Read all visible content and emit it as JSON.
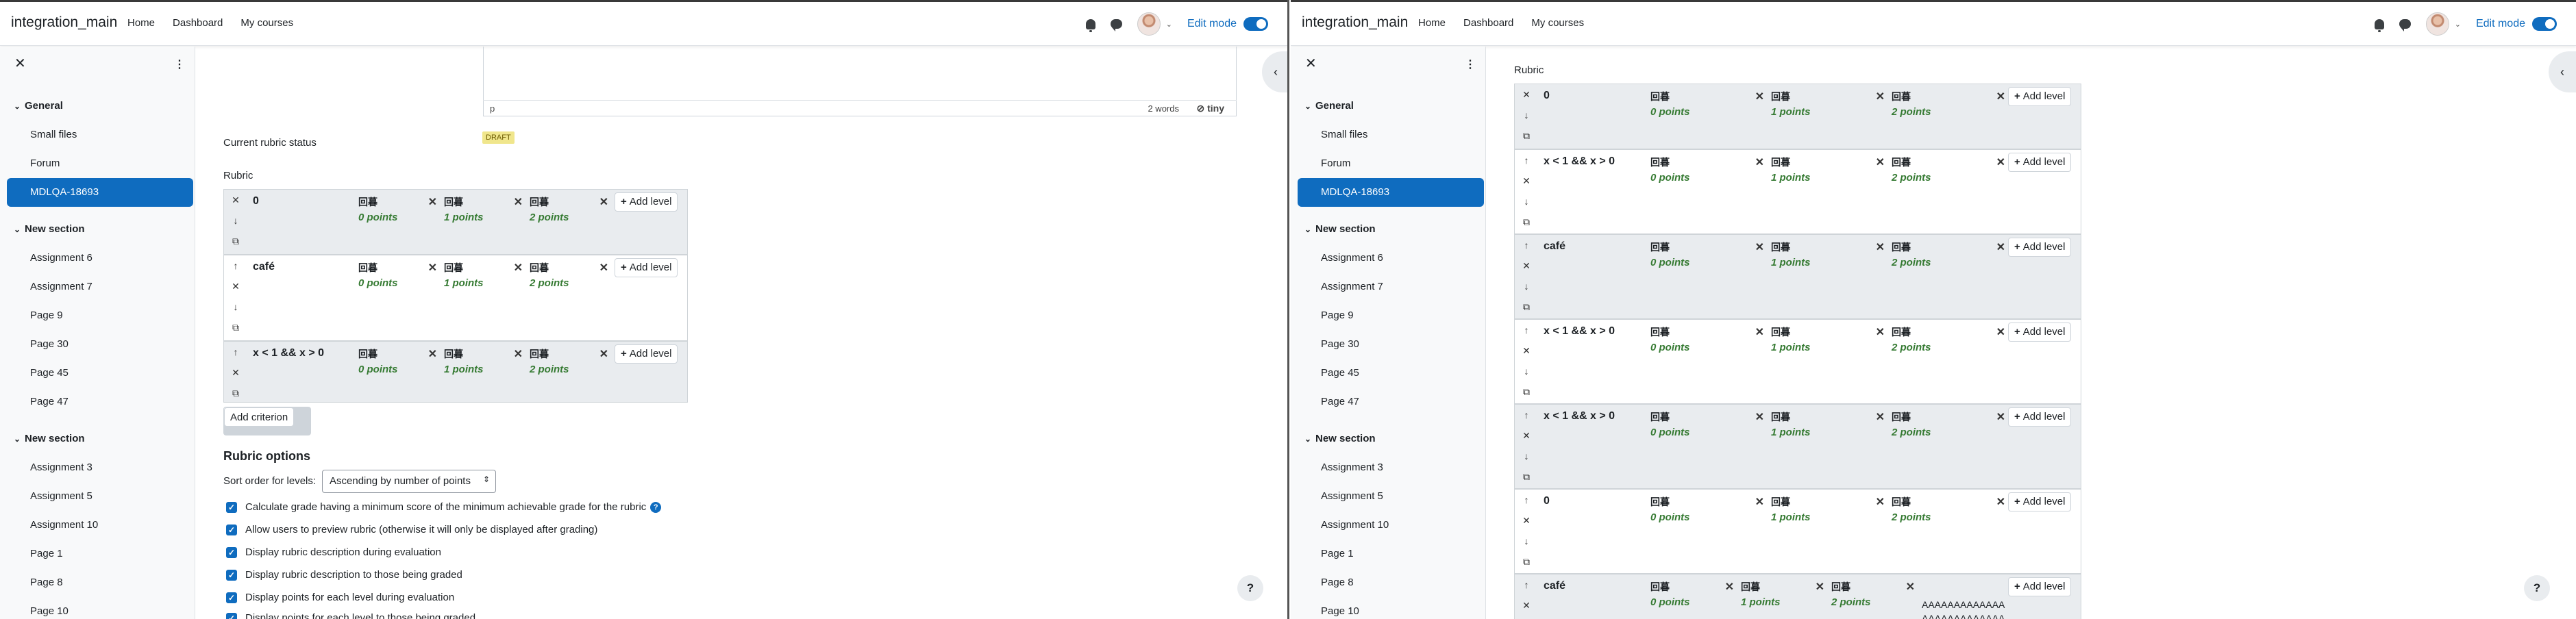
{
  "navbar": {
    "brand": "integration_main",
    "links": [
      "Home",
      "Dashboard",
      "My courses"
    ],
    "edit_mode_label": "Edit mode"
  },
  "drawer": {
    "close_glyph": "✕",
    "menu_glyph": "⋮",
    "sections": [
      {
        "title": "General",
        "items": [
          "Small files",
          "Forum",
          "MDLQA-18693"
        ]
      },
      {
        "title": "New section",
        "items": [
          "Assignment 6",
          "Assignment 7",
          "Page 9",
          "Page 30",
          "Page 45",
          "Page 47"
        ]
      },
      {
        "title": "New section",
        "items": [
          "Assignment 3",
          "Assignment 5",
          "Assignment 10",
          "Page 1",
          "Page 8",
          "Page 10"
        ]
      }
    ],
    "active_item": "MDLQA-18693"
  },
  "editor": {
    "status_path": "p",
    "word_count": "2 words",
    "brand": "tiny"
  },
  "current_status_label": "Current rubric status",
  "draft_badge": "DRAFT",
  "rubric_label": "Rubric",
  "add_level_label": "Add level",
  "add_criterion_label": "Add criterion",
  "level_defs": [
    "回暮",
    "回暮",
    "回暮"
  ],
  "level_points": [
    "0 points",
    "1 points",
    "2 points"
  ],
  "left_criteria": [
    {
      "name": "0"
    },
    {
      "name": "café"
    },
    {
      "name": "x < 1 && x > 0"
    }
  ],
  "right_criteria": [
    {
      "name": "0"
    },
    {
      "name": "x < 1 && x > 0"
    },
    {
      "name": "café"
    },
    {
      "name": "x < 1 && x > 0"
    },
    {
      "name": "x < 1 && x > 0"
    },
    {
      "name": "0"
    },
    {
      "name": "café"
    }
  ],
  "long_level_text": "AAAAAAAAAAAAAAAAAAAAAAAAAAAAAAAAAA",
  "options": {
    "title": "Rubric options",
    "sort_label": "Sort order for levels:",
    "sort_value": "Ascending by number of points",
    "checkboxes": [
      "Calculate grade having a minimum score of the minimum achievable grade for the rubric",
      "Allow users to preview rubric (otherwise it will only be displayed after grading)",
      "Display rubric description during evaluation",
      "Display rubric description to those being graded",
      "Display points for each level during evaluation",
      "Display points for each level to those being graded"
    ]
  },
  "help_glyph": "?",
  "colors": {
    "accent": "#0f6cbf",
    "points": "#357a32",
    "criterion_bg": "#e9ecef"
  }
}
